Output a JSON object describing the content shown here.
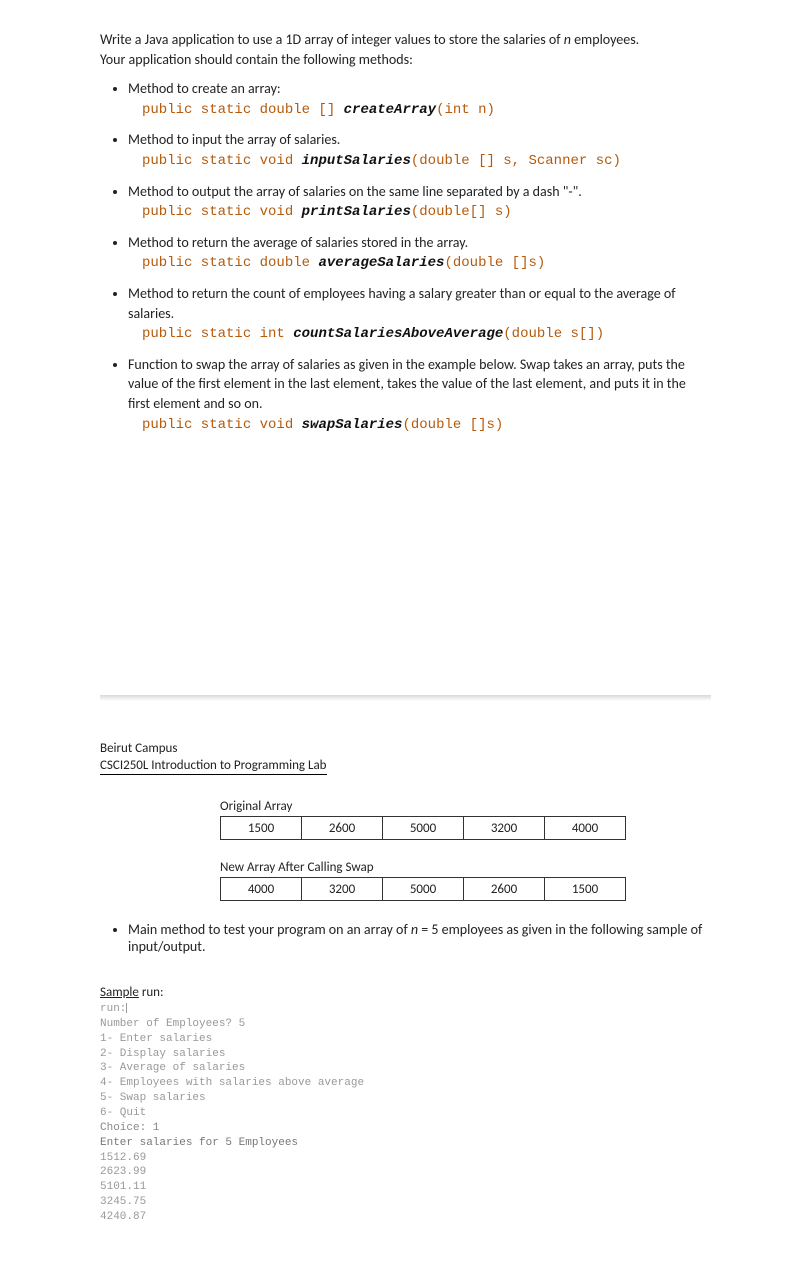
{
  "intro": {
    "line1a": "Write a Java application to use a 1D array of integer values to store the salaries of ",
    "line1b": "n",
    "line1c": " employees.",
    "line2": "Your application should contain the following methods:"
  },
  "methods": [
    {
      "desc": "Method to create an array:",
      "sig_prefix": "public static double []  ",
      "sig_name": "createArray",
      "sig_args": "(int n)"
    },
    {
      "desc": "Method to input the array of salaries.",
      "sig_prefix": "public static void ",
      "sig_name": "inputSalaries",
      "sig_args": "(double [] s, Scanner sc)"
    },
    {
      "desc": "Method to output the array of salaries on the same line separated by a dash \"-\".",
      "sig_prefix": "public static void ",
      "sig_name": "printSalaries",
      "sig_args": "(double[] s)"
    },
    {
      "desc": "Method to return the average of salaries stored in the array.",
      "sig_prefix": "public static double ",
      "sig_name": "averageSalaries",
      "sig_args": "(double []s)"
    },
    {
      "desc": "Method to return the count of employees having a salary greater than or equal to the average of salaries.",
      "sig_prefix": "public static int ",
      "sig_name": "countSalariesAboveAverage",
      "sig_args": "(double s[])"
    },
    {
      "desc": "Function to swap the array of salaries as given in the example below. Swap takes an array, puts the value of the first element in the last element, takes the value of the last element, and puts it in the first element and so on.",
      "sig_prefix": "public static void ",
      "sig_name": "swapSalaries",
      "sig_args": "(double []s)"
    }
  ],
  "footer": {
    "campus": "Beirut Campus",
    "course": "CSCI250L Introduction to Programming Lab"
  },
  "arrays": {
    "original_label": "Original Array",
    "original": [
      "1500",
      "2600",
      "5000",
      "3200",
      "4000"
    ],
    "swapped_label": "New Array After Calling Swap",
    "swapped": [
      "4000",
      "3200",
      "5000",
      "2600",
      "1500"
    ]
  },
  "main_note_a": "Main method to test your program on an array of ",
  "main_note_b": "n",
  "main_note_c": " = 5 employees as given in the following sample of input/output.",
  "sample": {
    "heading_u": "Sample",
    "heading_rest": " run:",
    "lines": [
      "run:",
      "Number of Employees? 5",
      "1- Enter salaries",
      "2- Display salaries",
      "3- Average of salaries",
      "4- Employees with salaries above average",
      "5- Swap salaries",
      "6- Quit",
      "Choice: 1",
      "Enter salaries for 5 Employees",
      "1512.69",
      "2623.99",
      "5101.11",
      "3245.75",
      "4240.87"
    ]
  }
}
